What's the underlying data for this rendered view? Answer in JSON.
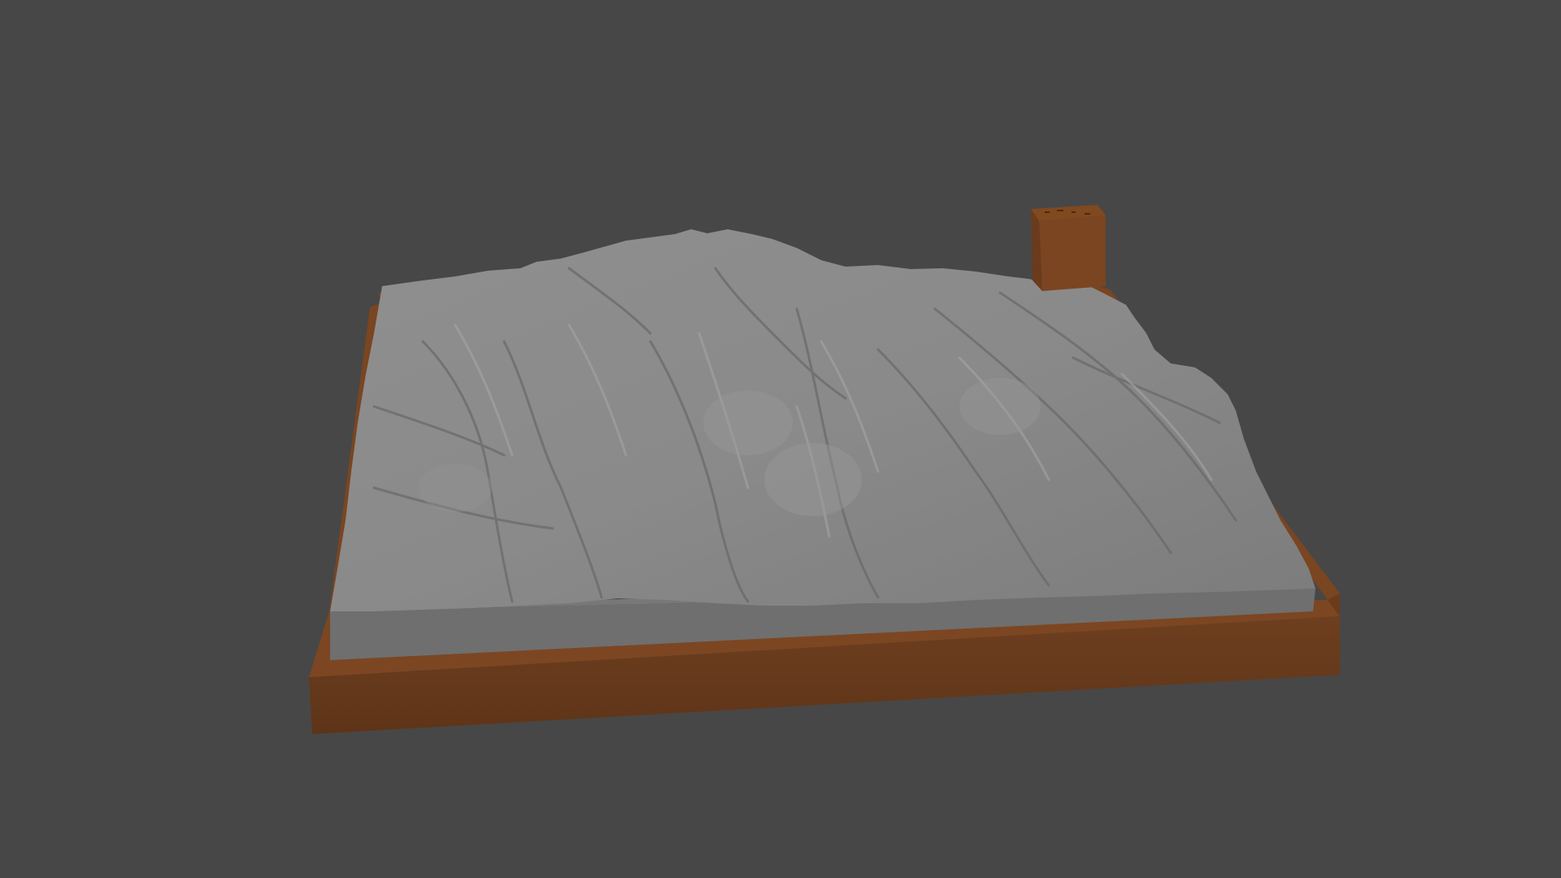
{
  "scene": {
    "background_color": "#474747",
    "objects": [
      {
        "name": "terrain-relief-model",
        "color": "#8a8a8a"
      },
      {
        "name": "wooden-base-frame",
        "color": "#6b3d1f"
      },
      {
        "name": "label-block",
        "color": "#7a4520"
      }
    ]
  }
}
